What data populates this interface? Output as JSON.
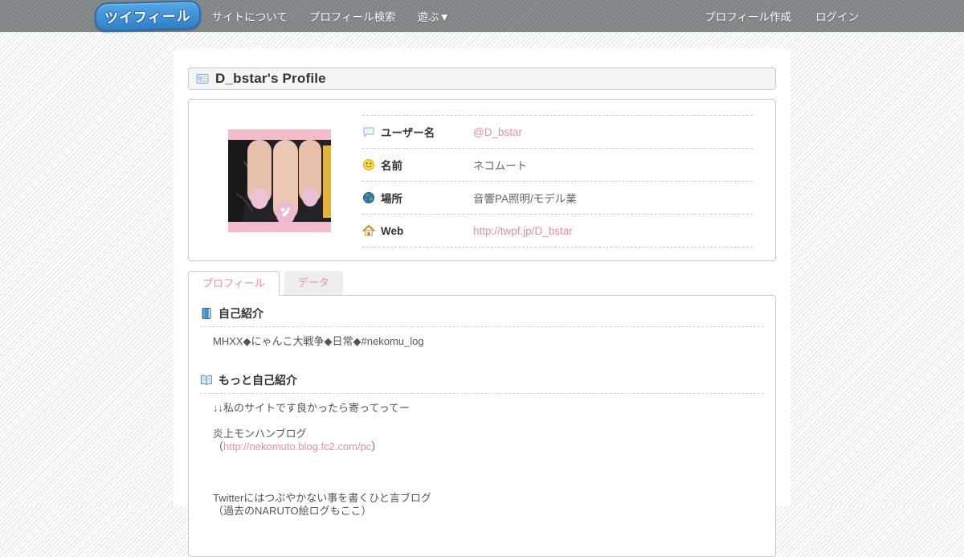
{
  "navbar": {
    "logo_text": "ツイフィール",
    "links": [
      {
        "label": "サイトについて"
      },
      {
        "label": "プロフィール検索"
      },
      {
        "label": "遊ぶ▼"
      }
    ],
    "right_links": [
      {
        "label": "プロフィール作成"
      },
      {
        "label": "ログイン"
      }
    ]
  },
  "page": {
    "title": "D_bstar's Profile"
  },
  "profile": {
    "rows": [
      {
        "icon": "speech-bubble",
        "label": "ユーザー名",
        "value": "@D_bstar"
      },
      {
        "icon": "smiley",
        "label": "名前",
        "value": "ネコムート"
      },
      {
        "icon": "globe",
        "label": "場所",
        "value": "音響PA照明/モデル業"
      },
      {
        "icon": "home",
        "label": "Web",
        "value": "http://twpf.jp/D_bstar"
      }
    ]
  },
  "tabs": [
    {
      "label": "プロフィール",
      "active": true
    },
    {
      "label": "データ",
      "active": false
    }
  ],
  "sections": {
    "intro": {
      "title": "自己紹介",
      "text": "MHXX◆にゃんこ大戦争◆日常◆#nekomu_log"
    },
    "more": {
      "title": "もっと自己紹介",
      "line1": "↓↓私のサイトです良かったら寄ってってー",
      "line2": "炎上モンハンブログ",
      "link_open": "（",
      "link": "http://nekomuto.blog.fc2.com/pc",
      "link_close": "）",
      "line3": "Twitterにはつぶやかない事を書くひと言ブログ",
      "line4": "（過去のNARUTO絵ログもここ）"
    }
  },
  "colors": {
    "link_pink": "#e8919f",
    "navbar_gray": "#838989",
    "stripe_blue": "#dde4e9"
  }
}
